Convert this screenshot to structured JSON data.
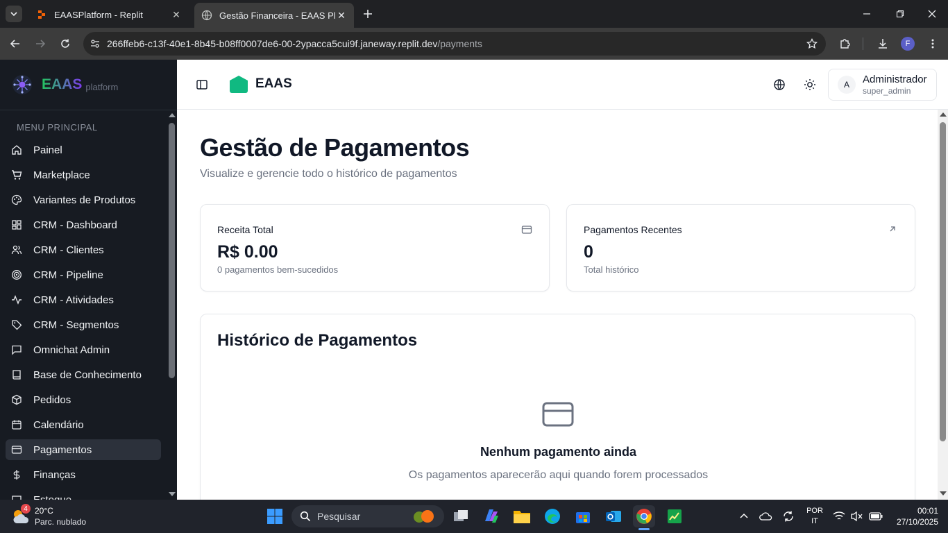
{
  "browser": {
    "tabs": [
      {
        "title": "EAASPlatform - Replit",
        "active": false
      },
      {
        "title": "Gestão Financeira - EAAS Platfo",
        "active": true
      }
    ],
    "url_host": "266ffeb6-c13f-40e1-8b45-b08ff0007de6-00-2ypacca5cui9f.janeway.replit.dev",
    "url_path": "/payments",
    "profile_initial": "F"
  },
  "sidebar": {
    "brand_name": "EAAS",
    "brand_sub": "platform",
    "section_label": "MENU PRINCIPAL",
    "items": [
      {
        "label": "Painel",
        "icon": "home-icon"
      },
      {
        "label": "Marketplace",
        "icon": "shopping-cart-icon"
      },
      {
        "label": "Variantes de Produtos",
        "icon": "palette-icon"
      },
      {
        "label": "CRM - Dashboard",
        "icon": "dashboard-grid-icon"
      },
      {
        "label": "CRM - Clientes",
        "icon": "users-icon"
      },
      {
        "label": "CRM - Pipeline",
        "icon": "target-icon"
      },
      {
        "label": "CRM - Atividades",
        "icon": "activity-icon"
      },
      {
        "label": "CRM - Segmentos",
        "icon": "tag-icon"
      },
      {
        "label": "Omnichat Admin",
        "icon": "message-square-icon"
      },
      {
        "label": "Base de Conhecimento",
        "icon": "book-icon"
      },
      {
        "label": "Pedidos",
        "icon": "package-icon"
      },
      {
        "label": "Calendário",
        "icon": "calendar-icon"
      },
      {
        "label": "Pagamentos",
        "icon": "credit-card-icon",
        "active": true
      },
      {
        "label": "Finanças",
        "icon": "dollar-sign-icon"
      },
      {
        "label": "Estoque",
        "icon": "box-icon"
      }
    ]
  },
  "header": {
    "logo_text": "EAAS",
    "user_initial": "A",
    "user_name": "Administrador",
    "user_role": "super_admin"
  },
  "page": {
    "title": "Gestão de Pagamentos",
    "subtitle": "Visualize e gerencie todo o histórico de pagamentos",
    "stats": [
      {
        "label": "Receita Total",
        "value": "R$ 0.00",
        "note": "0 pagamentos bem-sucedidos",
        "icon": "credit-card-icon"
      },
      {
        "label": "Pagamentos Recentes",
        "value": "0",
        "note": "Total histórico",
        "icon": "arrow-up-right-icon"
      }
    ],
    "history": {
      "title": "Histórico de Pagamentos",
      "empty_title": "Nenhum pagamento ainda",
      "empty_text": "Os pagamentos aparecerão aqui quando forem processados"
    }
  },
  "taskbar": {
    "weather_temp": "20°C",
    "weather_desc": "Parc. nublado",
    "weather_badge": "4",
    "search_placeholder": "Pesquisar",
    "lang_top": "POR",
    "lang_bottom": "IT",
    "time": "00:01",
    "date": "27/10/2025"
  },
  "colors": {
    "sidebar_bg": "#171b22",
    "brand_gradient_start": "#22c55e",
    "brand_gradient_end": "#7c3aed",
    "logo_green": "#10b981",
    "chrome_dark": "#202124"
  }
}
